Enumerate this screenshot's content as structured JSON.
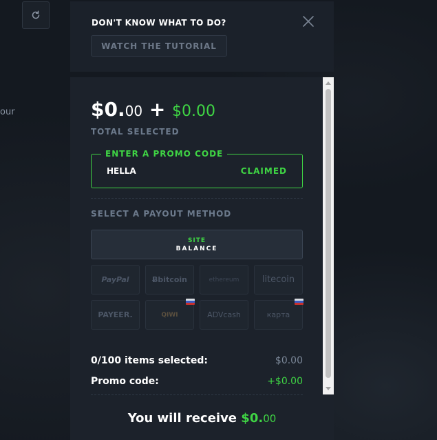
{
  "background": {
    "left_text": "our"
  },
  "toolbar": {
    "refresh_icon": "refresh-icon"
  },
  "tutorial": {
    "title": "DON'T KNOW WHAT TO DO?",
    "button_label": "WATCH THE TUTORIAL",
    "close_icon": "close-icon"
  },
  "summary_header": {
    "amount_main": "$0.",
    "amount_cents": "00",
    "plus": "+",
    "bonus": "$0.00",
    "label": "TOTAL SELECTED"
  },
  "promo": {
    "legend": "ENTER A PROMO CODE",
    "code": "HELLA",
    "status": "CLAIMED"
  },
  "payout": {
    "label": "SELECT A PAYOUT METHOD",
    "site_balance_line1": "SITE",
    "site_balance_line2": "BALANCE",
    "methods": [
      {
        "name": "PayPal",
        "icon": "paypal-icon"
      },
      {
        "name": "Ƀbitcoin",
        "icon": "bitcoin-icon"
      },
      {
        "name": "ethereum",
        "icon": "ethereum-icon"
      },
      {
        "name": "litecoin",
        "icon": "litecoin-icon"
      },
      {
        "name": "PAYEER.",
        "icon": "payeer-icon"
      },
      {
        "name": "QIWI",
        "icon": "qiwi-icon"
      },
      {
        "name": "ADVcash",
        "icon": "advcash-icon"
      },
      {
        "name": "карта",
        "icon": "card-icon"
      }
    ]
  },
  "totals": {
    "items_label": "0/100 items selected:",
    "items_value": "$0.00",
    "promo_label": "Promo code:",
    "promo_value": "+$0.00"
  },
  "receive": {
    "label": "You will receive",
    "amount_main": "$0.",
    "amount_cents": "00"
  },
  "colors": {
    "accent_green": "#3fd544",
    "panel": "#1c222b",
    "muted": "#6c7a8c"
  }
}
